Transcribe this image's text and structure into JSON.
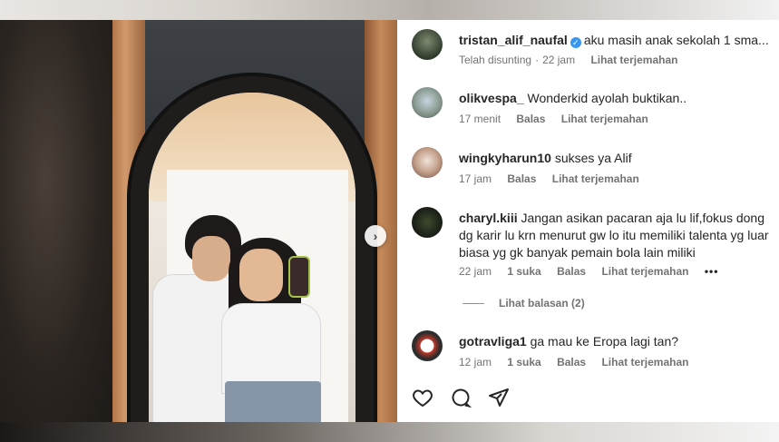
{
  "post": {
    "author": "tristan_alif_naufal",
    "caption": "aku masih anak sekolah 1 sma...",
    "edited": "Telah disunting",
    "time": "22 jam",
    "translate": "Lihat terjemahan"
  },
  "comments": [
    {
      "username": "olikvespa_",
      "text": "Wonderkid ayolah buktikan..",
      "time": "17 menit",
      "likes": "",
      "reply": "Balas",
      "translate": "Lihat terjemahan"
    },
    {
      "username": "wingkyharun10",
      "text": "sukses ya Alif",
      "time": "17 jam",
      "likes": "",
      "reply": "Balas",
      "translate": "Lihat terjemahan"
    },
    {
      "username": "charyl.kiii",
      "text": "Jangan asikan pacaran aja lu lif,fokus dong dg karir lu krn menurut gw lo itu memiliki talenta yg luar biasa yg gk banyak pemain bola lain miliki",
      "time": "22 jam",
      "likes": "1 suka",
      "reply": "Balas",
      "translate": "Lihat terjemahan",
      "more": "•••",
      "view_replies": "Lihat balasan (2)"
    },
    {
      "username": "gotravliga1",
      "text": "ga mau ke Eropa lagi tan?",
      "time": "12 jam",
      "likes": "1 suka",
      "reply": "Balas",
      "translate": "Lihat terjemahan"
    }
  ],
  "icons": {
    "next": "chevron-right-icon",
    "like": "heart-icon",
    "comment": "comment-icon",
    "share": "send-icon",
    "verified": "verified-badge-icon"
  },
  "colors": {
    "text": "#262626",
    "meta": "#737373",
    "verified": "#3897f0"
  }
}
